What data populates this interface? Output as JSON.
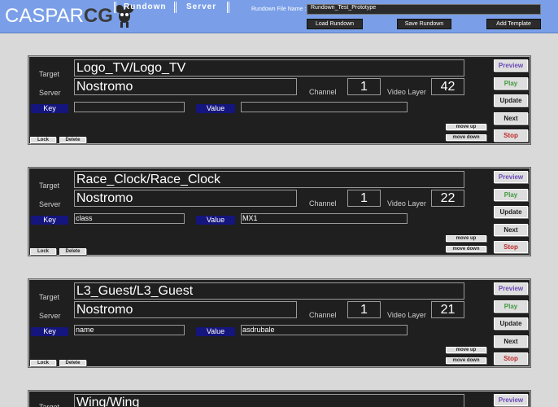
{
  "header": {
    "logo_text": "CASPAR",
    "logo_suffix": "CG",
    "nav": [
      {
        "label": "Rundown"
      },
      {
        "label": "Server"
      }
    ],
    "rundown_file_label": "Rundown File Name :",
    "rundown_file_value": "Rundown_Test_Prototype",
    "load_label": "Load Rundown",
    "save_label": "Save Rundown",
    "add_label": "Add Template"
  },
  "labels": {
    "target": "Target",
    "server": "Server",
    "channel": "Channel",
    "video_layer": "Video Layer",
    "key": "Key",
    "value": "Value",
    "lock": "Lock",
    "delete": "Delete",
    "move_up": "move up",
    "move_down": "move down",
    "preview": "Preview",
    "play": "Play",
    "update": "Update",
    "next": "Next",
    "stop": "Stop"
  },
  "colors": {
    "preview": "#6a4ab8",
    "play": "#3f9a3f",
    "update": "#222222",
    "next": "#222222",
    "stop": "#c02a2a"
  },
  "templates": [
    {
      "target": "Logo_TV/Logo_TV",
      "server": "Nostromo",
      "channel": "1",
      "layer": "42",
      "key": "",
      "value": ""
    },
    {
      "target": "Race_Clock/Race_Clock",
      "server": "Nostromo",
      "channel": "1",
      "layer": "22",
      "key": "class",
      "value": "MX1"
    },
    {
      "target": "L3_Guest/L3_Guest",
      "server": "Nostromo",
      "channel": "1",
      "layer": "21",
      "key": "name",
      "value": "asdrubale"
    },
    {
      "target": "Wing/Wing",
      "server": "",
      "channel": "",
      "layer": "",
      "key": "",
      "value": ""
    }
  ]
}
